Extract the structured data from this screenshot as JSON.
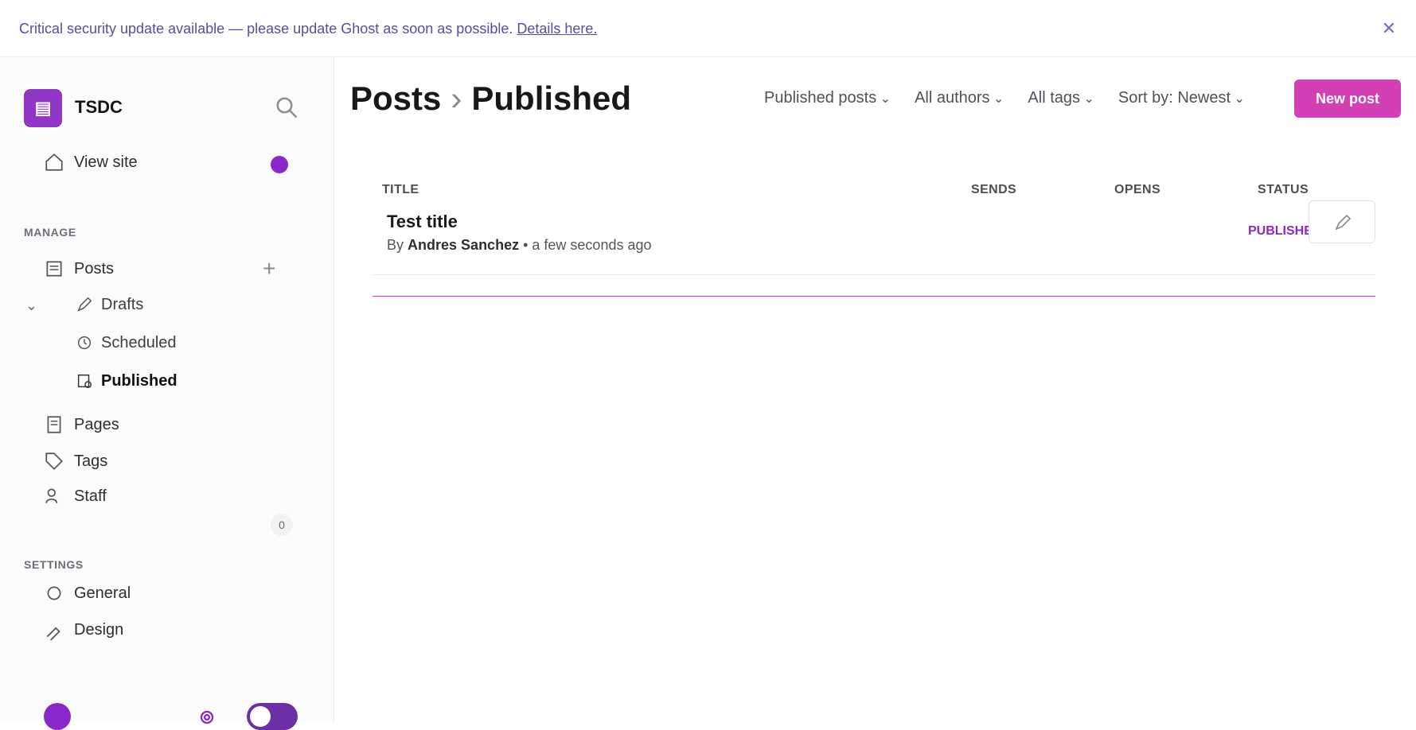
{
  "banner": {
    "text": "Critical security update available — please update Ghost as soon as possible.",
    "link": "Details here."
  },
  "brand": {
    "name": "TSDC"
  },
  "nav": {
    "view_site": "View site",
    "manage_label": "MANAGE",
    "posts": "Posts",
    "drafts": "Drafts",
    "scheduled": "Scheduled",
    "published": "Published",
    "pages": "Pages",
    "tags": "Tags",
    "staff": "Staff",
    "settings_label": "SETTINGS",
    "general": "General",
    "design": "Design",
    "members_badge": "0"
  },
  "main": {
    "title_parent": "Posts",
    "title_current": "Published",
    "filters": [
      "Published posts",
      "All authors",
      "All tags",
      "Sort by: Newest"
    ],
    "new_post": "New post",
    "columns": {
      "title": "TITLE",
      "sends": "SENDS",
      "opens": "OPENS",
      "status": "STATUS"
    },
    "rows": [
      {
        "title": "Test title",
        "by": "By",
        "author": "Andres Sanchez",
        "time": "• a few seconds ago",
        "status": "PUBLISHED"
      }
    ]
  },
  "colors": {
    "accent": "#d33fb5",
    "brand": "#8f36c7"
  }
}
